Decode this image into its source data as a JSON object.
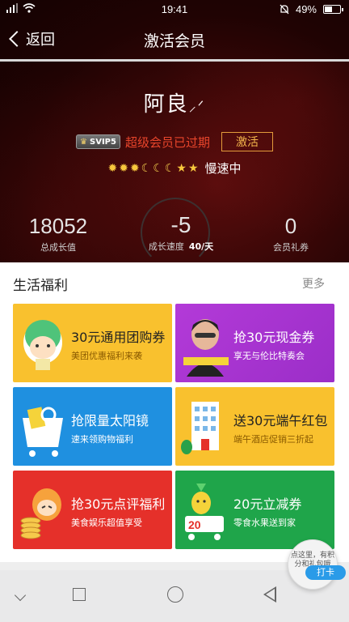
{
  "status_bar": {
    "time": "19:41",
    "battery": "49%"
  },
  "nav": {
    "back_label": "返回",
    "title": "激活会员"
  },
  "profile": {
    "name": "阿良",
    "vip_badge": "SVIP5",
    "vip_status": "超级会员已过期",
    "activate_label": "激活",
    "speed_status": "慢速中"
  },
  "stats": {
    "growth_value": "18052",
    "growth_label": "总成长值",
    "speed_value": "-5",
    "speed_label": "成长速度",
    "speed_rate": "40/天",
    "coupon_value": "0",
    "coupon_label": "会员礼券"
  },
  "section": {
    "title": "生活福利",
    "more_label": "更多",
    "cards": [
      {
        "title": "30元通用团购券",
        "subtitle": "美团优惠福利来袭"
      },
      {
        "title": "抢30元现金券",
        "subtitle": "享无与伦比特奏会"
      },
      {
        "title": "抢限量太阳镜",
        "subtitle": "速来领购物福利"
      },
      {
        "title": "送30元端午红包",
        "subtitle": "端午酒店促销三折起"
      },
      {
        "title": "抢30元点评福利",
        "subtitle": "美食娱乐超值享受"
      },
      {
        "title": "20元立减券",
        "subtitle": "零食水果送到家"
      }
    ]
  },
  "fab": {
    "text": "点这里，有积分和礼包哦",
    "tag": "打卡"
  },
  "colors": {
    "accent_red": "#e8452b",
    "activate_gold": "#e39b3b",
    "star_gold": "#f7c83d"
  }
}
